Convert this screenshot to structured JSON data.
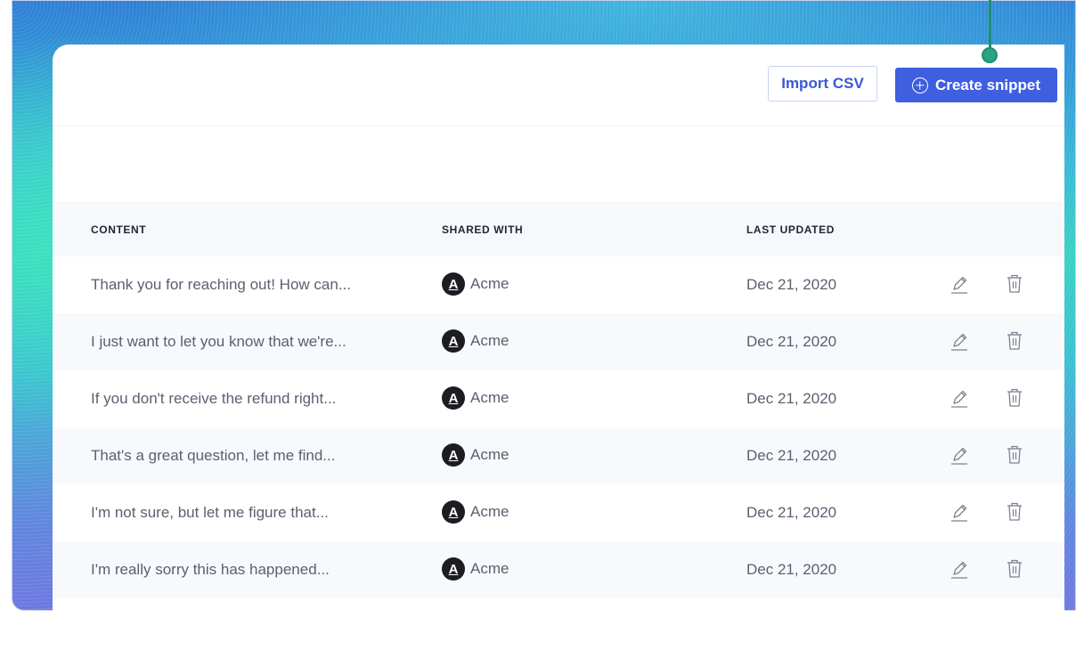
{
  "toolbar": {
    "import_label": "Import CSV",
    "create_label": "Create snippet"
  },
  "table": {
    "headers": {
      "content": "CONTENT",
      "shared_with": "SHARED WITH",
      "last_updated": "LAST UPDATED"
    },
    "rows": [
      {
        "content": "Thank you for reaching out! How can...",
        "avatar": "A",
        "shared": "Acme",
        "date": "Dec 21, 2020"
      },
      {
        "content": "I just want to let you know that we're...",
        "avatar": "A",
        "shared": "Acme",
        "date": "Dec 21, 2020"
      },
      {
        "content": "If you don't receive the refund right...",
        "avatar": "A",
        "shared": "Acme",
        "date": "Dec 21, 2020"
      },
      {
        "content": "That's a great question, let me find...",
        "avatar": "A",
        "shared": "Acme",
        "date": "Dec 21, 2020"
      },
      {
        "content": "I'm not sure, but let me  figure that...",
        "avatar": "A",
        "shared": "Acme",
        "date": "Dec 21, 2020"
      },
      {
        "content": "I'm really sorry this has happened...",
        "avatar": "A",
        "shared": "Acme",
        "date": "Dec 21, 2020"
      }
    ]
  },
  "icons": {
    "create": "plus-circle-icon",
    "edit": "pencil-icon",
    "delete": "trash-icon"
  },
  "colors": {
    "accent": "#3f5ee0",
    "import_text": "#3b57d9",
    "pointer": "#2aa384"
  }
}
